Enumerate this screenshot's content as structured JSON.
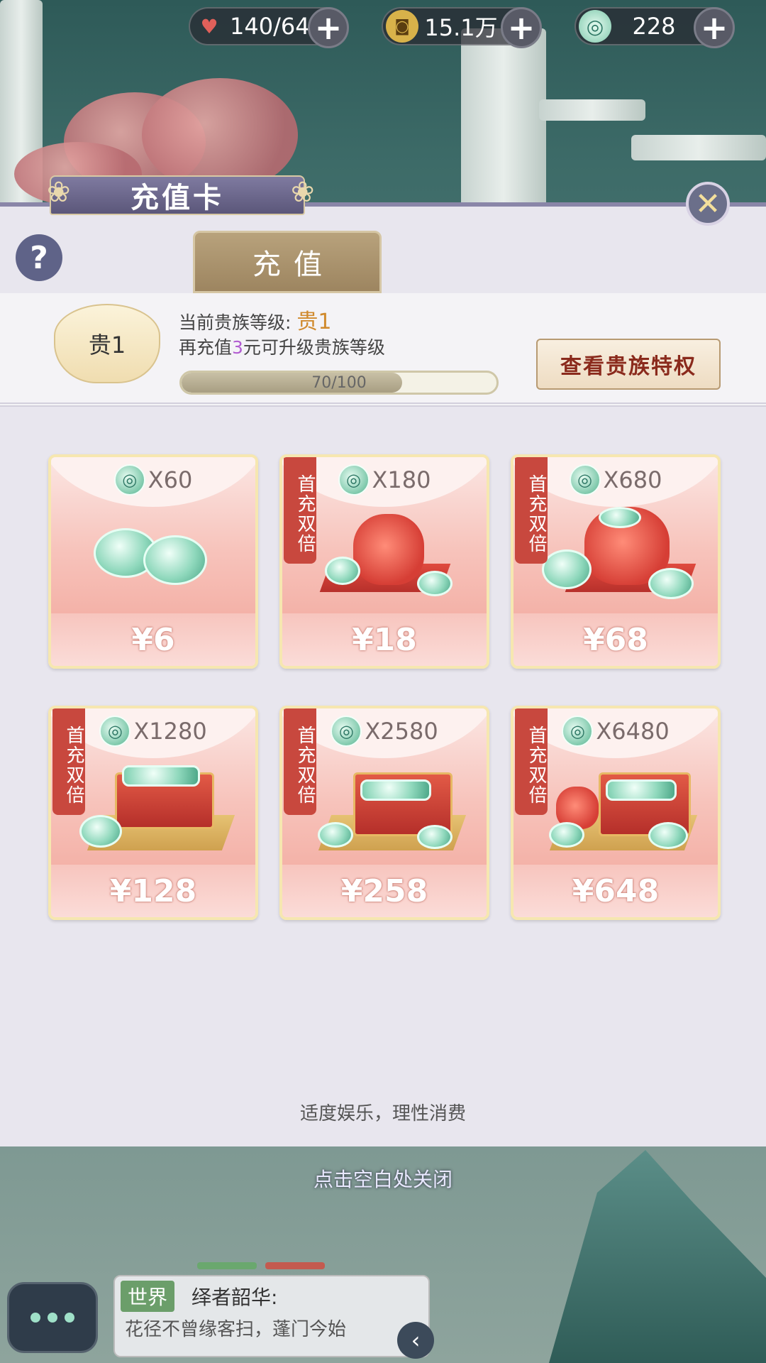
{
  "resources": [
    {
      "icon": "heart-icon",
      "icon_glyph": "♥",
      "value": "140/64",
      "color": "#e0605a"
    },
    {
      "icon": "coin-icon",
      "icon_glyph": "◙",
      "value": "15.1万",
      "color": "#d8b24a"
    },
    {
      "icon": "jade-icon",
      "icon_glyph": "◎",
      "value": "228",
      "color": "#7fc9ac"
    }
  ],
  "plus_label": "+",
  "panel": {
    "title": "充值卡",
    "close_label": "✕",
    "help_label": "?",
    "tab_label": "充值"
  },
  "noble": {
    "emblem": "贵1",
    "level_prefix": "当前贵族等级:",
    "level_value": "贵1",
    "line2_prefix": "再充值",
    "line2_amount": "3",
    "line2_suffix": "元可升级贵族等级",
    "progress_text": "70/100",
    "progress_fraction": 0.7,
    "privilege_button": "查看贵族特权"
  },
  "badge_text": "首充双倍",
  "cards": [
    {
      "qty": "X60",
      "price": "¥6",
      "badge": false
    },
    {
      "qty": "X180",
      "price": "¥18",
      "badge": true
    },
    {
      "qty": "X680",
      "price": "¥68",
      "badge": true
    },
    {
      "qty": "X1280",
      "price": "¥128",
      "badge": true
    },
    {
      "qty": "X2580",
      "price": "¥258",
      "badge": true
    },
    {
      "qty": "X6480",
      "price": "¥648",
      "badge": true
    }
  ],
  "footer_text": "适度娱乐，理性消费",
  "tap_close_text": "点击空白处关闭",
  "chat": {
    "channel": "世界",
    "name": "绎者韶华:",
    "message": "花径不曾缘客扫，蓬门今始",
    "collapse_label": "‹"
  }
}
